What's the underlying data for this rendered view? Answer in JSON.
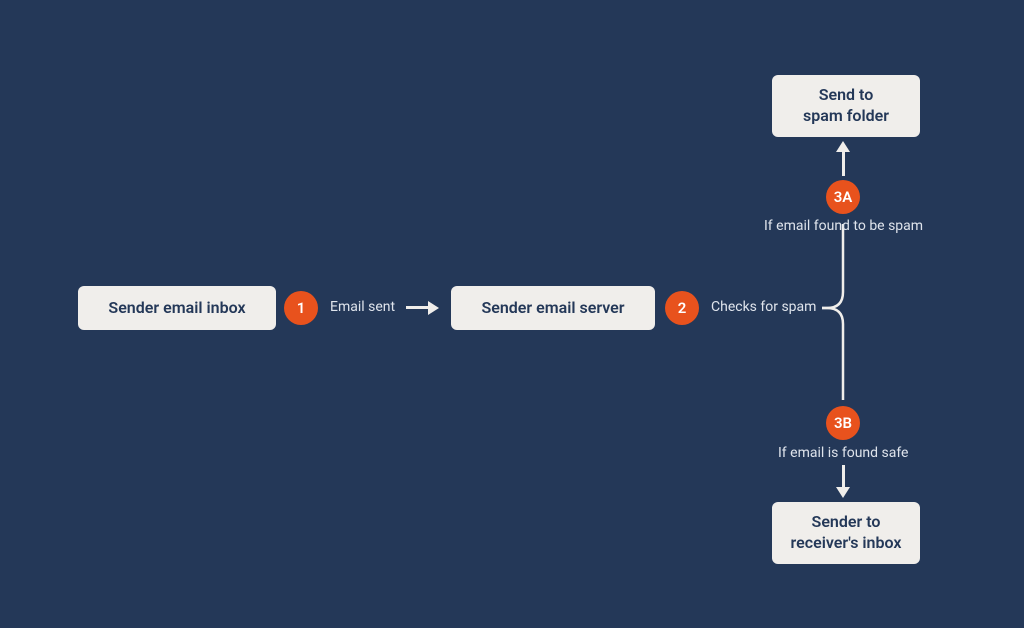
{
  "colors": {
    "bg": "#243858",
    "box_bg": "#f0eeeb",
    "box_text": "#243858",
    "badge": "#e8521d",
    "label": "#dfe4ec"
  },
  "nodes": {
    "sender_inbox": {
      "label": "Sender email inbox"
    },
    "sender_server": {
      "label": "Sender email server"
    },
    "spam_folder": {
      "label": "Send to\nspam folder"
    },
    "receiver_inbox": {
      "label": "Sender to\nreceiver's inbox"
    }
  },
  "steps": {
    "step1": {
      "num": "1",
      "label": "Email sent"
    },
    "step2": {
      "num": "2",
      "label": "Checks for spam"
    },
    "step3a": {
      "num": "3A",
      "label": "If email found to be spam"
    },
    "step3b": {
      "num": "3B",
      "label": "If email is found safe"
    }
  }
}
